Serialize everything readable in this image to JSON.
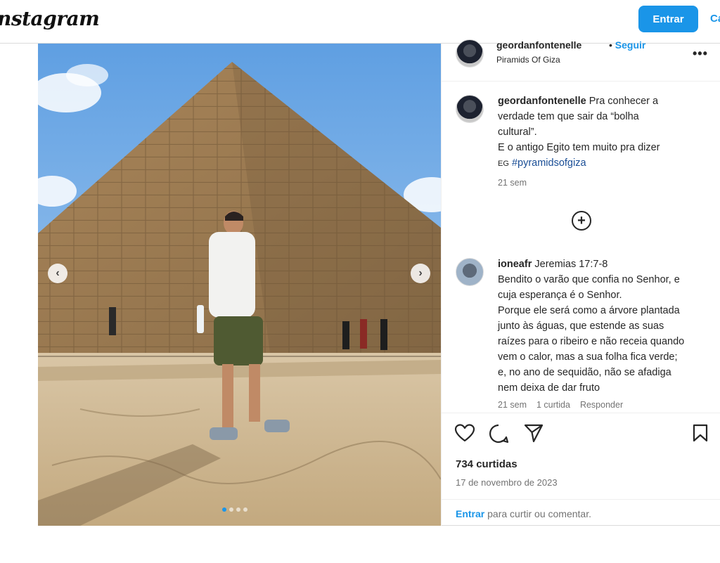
{
  "header": {
    "logo_text": "nstagram",
    "login_button": "Entrar",
    "signup_link": "Ca"
  },
  "post": {
    "author": "geordanfontenelle",
    "follow_label": "Seguir",
    "location": "Piramids Of Giza",
    "caption": {
      "author": "geordanfontenelle",
      "lines": [
        "Pra conhecer a",
        "verdade tem que sair da “bolha",
        "cultural”.",
        "E o antigo Egito tem muito pra dizer"
      ],
      "flag_text": "EG",
      "hashtag": "#pyramidsofgiza",
      "time": "21 sem"
    },
    "comment": {
      "author": "ioneafr",
      "first_line": "Jeremias 17:7-8",
      "lines": [
        "Bendito o varão que confia no Senhor, e",
        "cuja esperança é o Senhor.",
        "Porque ele será como a árvore plantada",
        "junto às águas, que estende as suas",
        "raízes para o ribeiro e não receia quando",
        "vem o calor, mas a sua folha fica verde;",
        "e, no ano de sequidão, não se afadiga",
        "nem deixa de dar fruto"
      ],
      "time": "21 sem",
      "likes": "1 curtida",
      "reply": "Responder"
    },
    "likes_count": "734 curtidas",
    "date": "17 de novembro de 2023",
    "login_prompt": {
      "link": "Entrar",
      "text": " para curtir ou comentar."
    },
    "carousel": {
      "slide_count": 4,
      "active_index": 0
    }
  },
  "colors": {
    "accent": "#1a95e8",
    "muted": "#737373",
    "text": "#262626"
  }
}
